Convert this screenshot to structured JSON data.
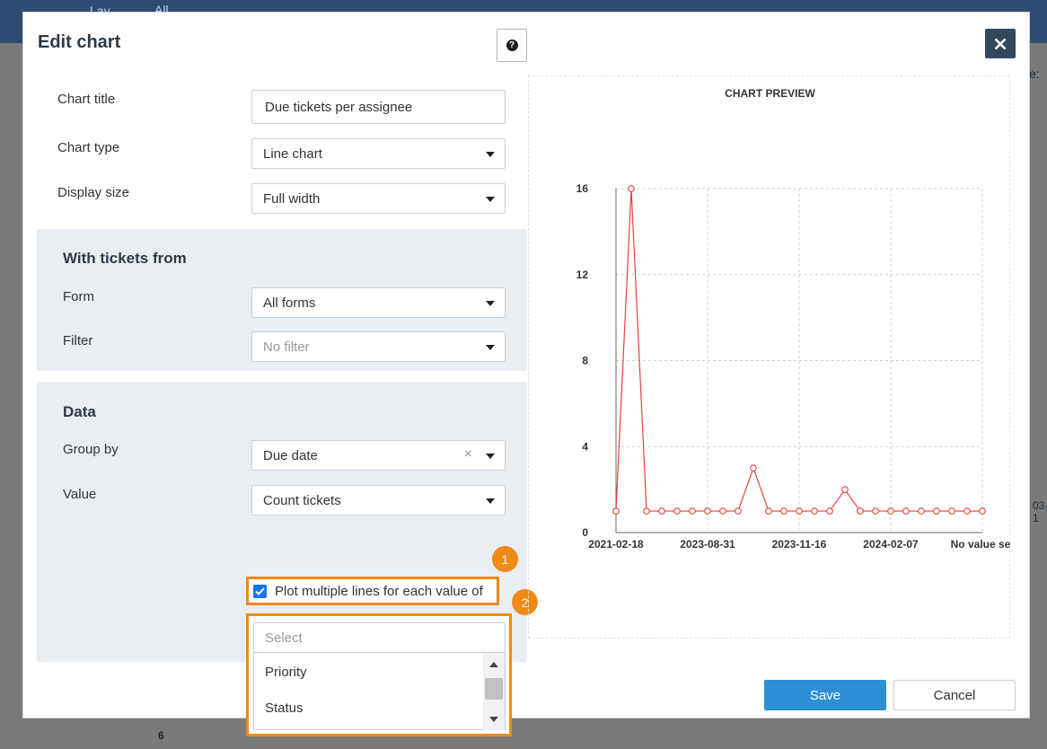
{
  "background": {
    "tab_1": "Lay...",
    "tab_2": "All",
    "right_text": "e:",
    "right_text_2": "03-1",
    "row_number": "6"
  },
  "modal": {
    "title": "Edit chart",
    "help_icon": "question-icon",
    "close_icon": "close-icon"
  },
  "form": {
    "chart_title_label": "Chart title",
    "chart_title_value": "Due tickets per assignee",
    "chart_type_label": "Chart type",
    "chart_type_value": "Line chart",
    "display_size_label": "Display size",
    "display_size_value": "Full width"
  },
  "tickets_panel": {
    "title": "With tickets from",
    "form_label": "Form",
    "form_value": "All forms",
    "filter_label": "Filter",
    "filter_placeholder": "No filter"
  },
  "data_panel": {
    "title": "Data",
    "group_by_label": "Group by",
    "group_by_value": "Due date",
    "clear_glyph": "×",
    "value_label": "Value",
    "value_value": "Count tickets",
    "multi_line_label": "Plot multiple lines for each value of",
    "multi_line_checked": true,
    "select_placeholder": "Select",
    "options": [
      "Priority",
      "Status"
    ]
  },
  "annotations": {
    "badge_1": "1",
    "badge_2": "2"
  },
  "buttons": {
    "save": "Save",
    "cancel": "Cancel"
  },
  "colors": {
    "accent_orange": "#f08a17",
    "save_blue": "#2d8fd5",
    "line_red": "#e8413a"
  },
  "chart_data": {
    "type": "line",
    "title": "CHART PREVIEW",
    "x_tick_labels": [
      "2021-02-18",
      "2023-08-31",
      "2023-11-16",
      "2024-02-07",
      "No value set"
    ],
    "y_ticks": [
      0,
      4,
      8,
      12,
      16
    ],
    "ylim": [
      0,
      16
    ],
    "grid": true,
    "series": [
      {
        "values": [
          1,
          16,
          1,
          1,
          1,
          1,
          1,
          1,
          1,
          3,
          1,
          1,
          1,
          1,
          1,
          2,
          1,
          1,
          1,
          1,
          1,
          1,
          1,
          1,
          1
        ]
      }
    ]
  }
}
